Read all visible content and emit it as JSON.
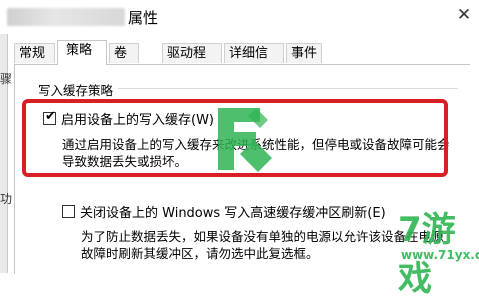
{
  "window": {
    "title": "属性",
    "close_glyph": "✕"
  },
  "left_strip": {
    "fragments": [
      "骤",
      "功"
    ]
  },
  "tabs": [
    {
      "label": "常规"
    },
    {
      "label": "策略"
    },
    {
      "label": "卷"
    },
    {
      "label": "驱动程序"
    },
    {
      "label": "详细信息"
    },
    {
      "label": "事件"
    }
  ],
  "active_tab": "策略",
  "write_cache_group": {
    "title": "写入缓存策略",
    "enable_cache": {
      "label": "启用设备上的写入缓存(W)",
      "checked": true,
      "description_line1": "通过启用设备上的写入缓存来改进系统性能，但停电或设备故障可能会",
      "description_line2": "导致数据丢失或损坏。"
    },
    "disable_flush": {
      "label": "关闭设备上的 Windows 写入高速缓存缓冲区刷新(E)",
      "checked": false,
      "description_line1": "为了防止数据丢失，如果设备没有单独的电源以允许该设备在电源",
      "description_line2": "故障时刷新其缓冲区，请勿选中此复选框。"
    }
  },
  "watermark": {
    "brand_text": "7游戏",
    "url": "www.71yx.cn",
    "color": "#2fb553"
  },
  "colors": {
    "highlight_border": "#d81f26"
  }
}
